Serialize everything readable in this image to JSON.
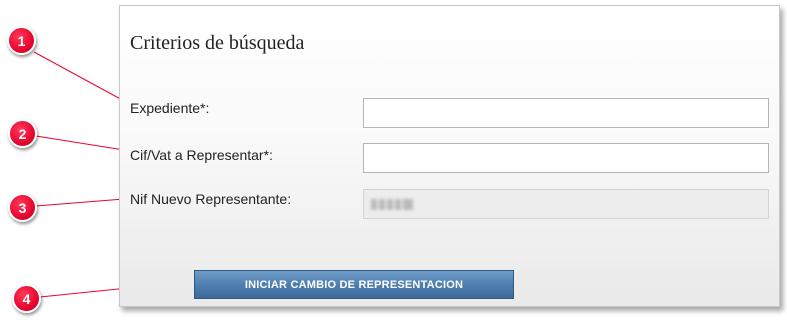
{
  "form": {
    "title": "Criterios de búsqueda",
    "fields": [
      {
        "label": "Expediente*:",
        "value": "",
        "placeholder": ""
      },
      {
        "label": "Cif/Vat a Representar*:",
        "value": "",
        "placeholder": ""
      },
      {
        "label": "Nif Nuevo Representante:",
        "value": "",
        "placeholder": ""
      }
    ],
    "submit_label": "INICIAR CAMBIO DE REPRESENTACION"
  },
  "callouts": [
    "1",
    "2",
    "3",
    "4"
  ],
  "colors": {
    "callout": "#e8062f",
    "button": "#4f7fb0",
    "line": "#e8062f"
  }
}
